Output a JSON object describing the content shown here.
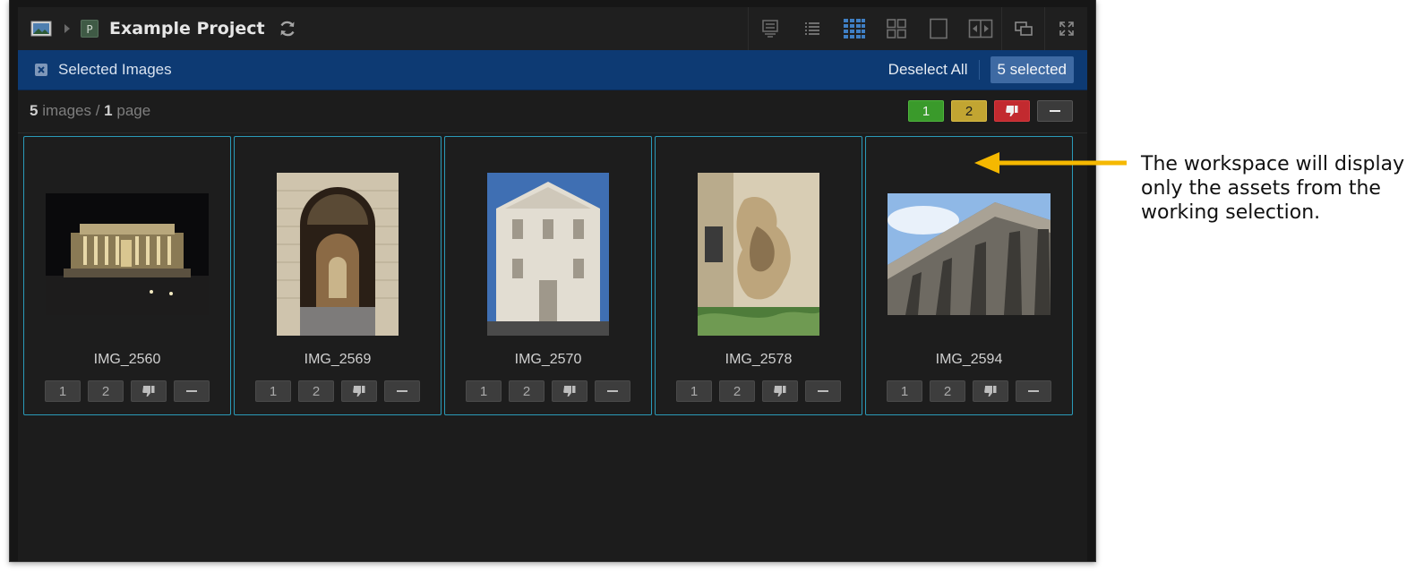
{
  "toolbar": {
    "project_badge": "P",
    "project_title": "Example Project"
  },
  "selection_bar": {
    "label": "Selected Images",
    "deselect_label": "Deselect All",
    "count_label": "5 selected"
  },
  "summary": {
    "image_count": "5",
    "images_word": " images / ",
    "page_count": "1",
    "page_word": " page"
  },
  "filters": {
    "rating1": "1",
    "rating2": "2",
    "reject_icon": "thumbs-down-icon",
    "none_icon": "dash-icon"
  },
  "images": [
    {
      "name": "IMG_2560",
      "orientation": "landscape"
    },
    {
      "name": "IMG_2569",
      "orientation": "portrait"
    },
    {
      "name": "IMG_2570",
      "orientation": "portrait"
    },
    {
      "name": "IMG_2578",
      "orientation": "portrait"
    },
    {
      "name": "IMG_2594",
      "orientation": "landscape"
    }
  ],
  "card_buttons": {
    "rating1": "1",
    "rating2": "2"
  },
  "annotation": {
    "text": "The workspace will display only the assets from the working selection."
  },
  "colors": {
    "selection_bar": "#0d3a73",
    "card_border": "#2a9ab8",
    "arrow": "#f5b800",
    "rating1": "#3a9a2b",
    "rating2": "#c2a532",
    "reject": "#c22a2f"
  }
}
